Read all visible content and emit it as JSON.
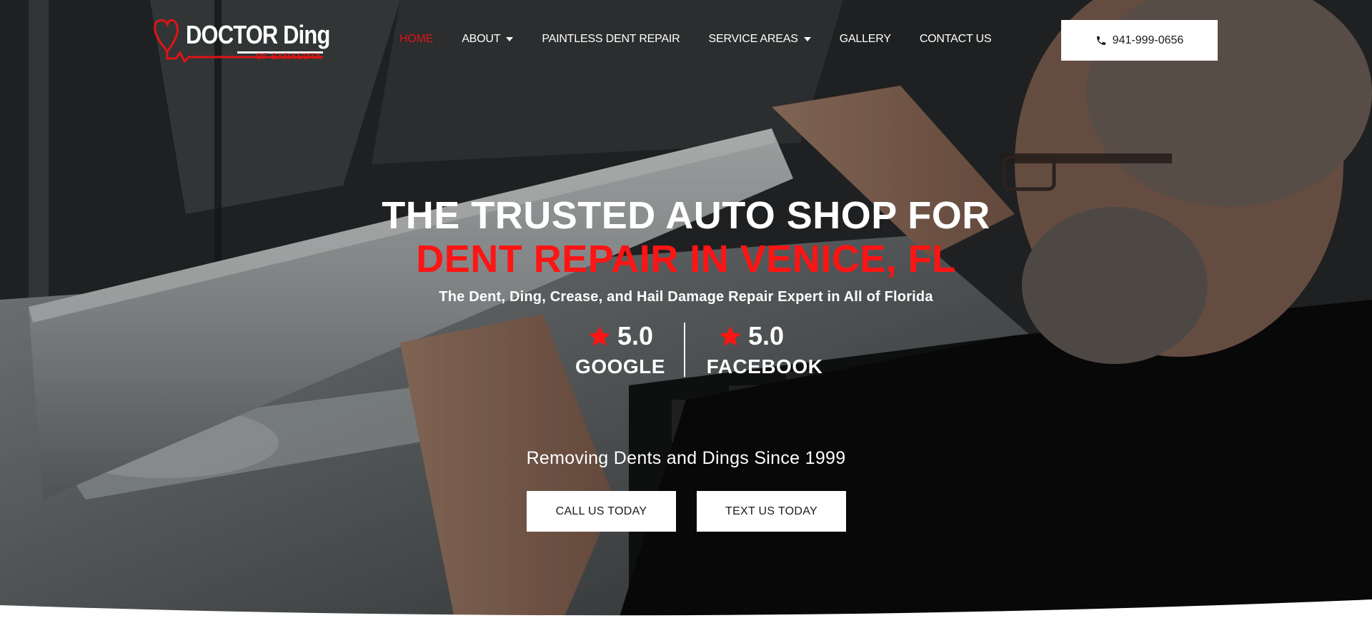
{
  "brand": {
    "logo_text": "DOCTOR Ding",
    "logo_subtext": "OF SARASOTA",
    "accent_color": "#e01414"
  },
  "nav": {
    "items": [
      {
        "label": "HOME",
        "active": true,
        "has_dropdown": false
      },
      {
        "label": "ABOUT",
        "active": false,
        "has_dropdown": true
      },
      {
        "label": "PAINTLESS DENT REPAIR",
        "active": false,
        "has_dropdown": false
      },
      {
        "label": "SERVICE AREAS",
        "active": false,
        "has_dropdown": true
      },
      {
        "label": "GALLERY",
        "active": false,
        "has_dropdown": false
      },
      {
        "label": "CONTACT US",
        "active": false,
        "has_dropdown": false
      }
    ],
    "phone_label": "941-999-0656",
    "phone_icon": "phone-icon"
  },
  "hero": {
    "headline_line1": "THE TRUSTED AUTO SHOP FOR",
    "headline_line2": "DENT REPAIR IN VENICE, FL",
    "tagline": "The Dent, Ding, Crease, and Hail Damage Repair Expert in All of Florida",
    "ratings": [
      {
        "score": "5.0",
        "source": "GOOGLE",
        "icon": "star-icon"
      },
      {
        "score": "5.0",
        "source": "FACEBOOK",
        "icon": "star-icon"
      }
    ],
    "since_text": "Removing Dents and Dings Since 1999",
    "call_button": "CALL US TODAY",
    "text_button": "TEXT US TODAY"
  }
}
